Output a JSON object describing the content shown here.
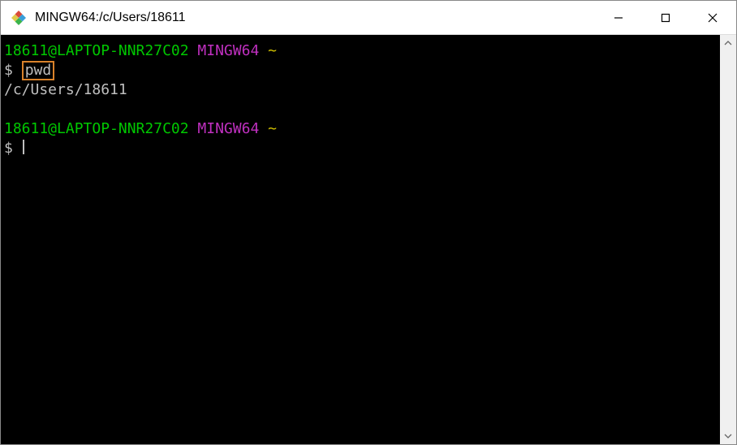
{
  "titlebar": {
    "title": "MINGW64:/c/Users/18611"
  },
  "terminal": {
    "prompt1_userhost": "18611@LAPTOP-NNR27C02",
    "prompt1_mingw": "MINGW64",
    "prompt1_path": "~",
    "prompt1_dollar": "$",
    "cmd1": "pwd",
    "output1": "/c/Users/18611",
    "prompt2_userhost": "18611@LAPTOP-NNR27C02",
    "prompt2_mingw": "MINGW64",
    "prompt2_path": "~",
    "prompt2_dollar": "$"
  },
  "colors": {
    "userhost": "#00c800",
    "mingw": "#c030c0",
    "path": "#d0c000",
    "highlight_border": "#d9822b",
    "terminal_bg": "#000000",
    "terminal_fg": "#bfbfbf"
  },
  "icons": {
    "app": "git-bash-icon",
    "minimize": "minimize-icon",
    "maximize": "maximize-icon",
    "close": "close-icon",
    "scroll_up": "chevron-up-icon",
    "scroll_down": "chevron-down-icon"
  }
}
